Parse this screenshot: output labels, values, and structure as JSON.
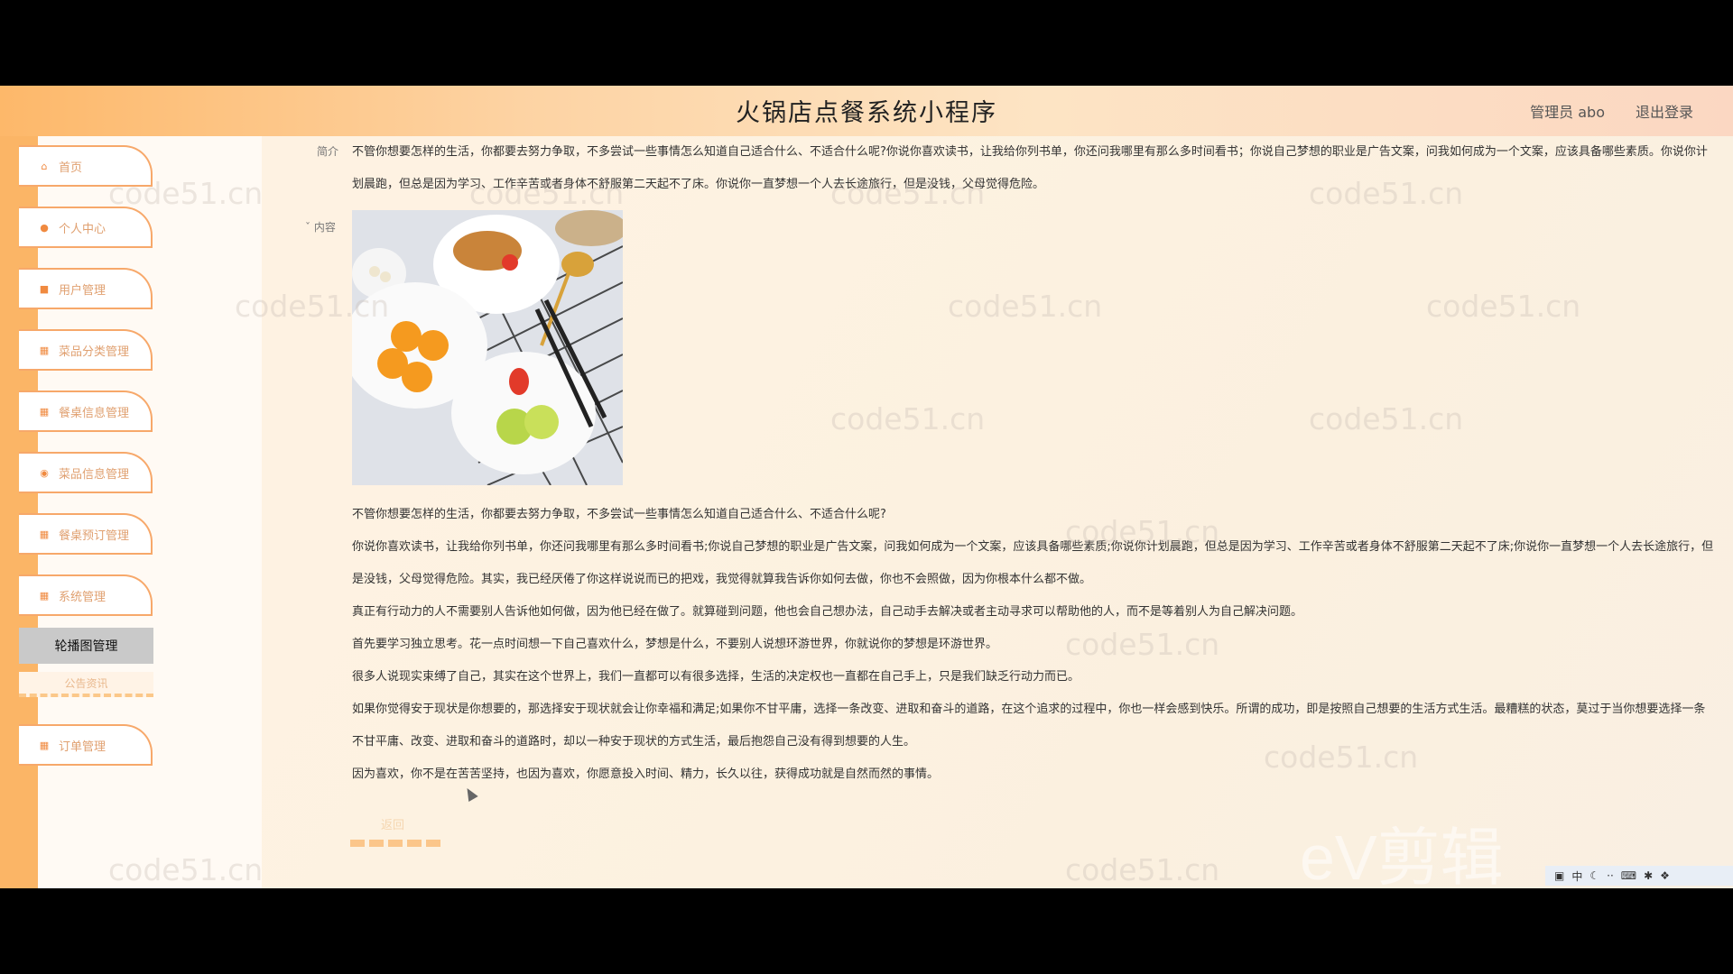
{
  "header": {
    "title": "火锅店点餐系统小程序",
    "user": "管理员 abo",
    "logout": "退出登录"
  },
  "sidebar": {
    "items": [
      {
        "label": "首页",
        "icon": "home-icon"
      },
      {
        "label": "个人中心",
        "icon": "user-icon"
      },
      {
        "label": "用户管理",
        "icon": "users-icon"
      },
      {
        "label": "菜品分类管理",
        "icon": "grid-icon"
      },
      {
        "label": "餐桌信息管理",
        "icon": "grid-icon"
      },
      {
        "label": "菜品信息管理",
        "icon": "info-icon"
      },
      {
        "label": "餐桌预订管理",
        "icon": "grid-icon"
      },
      {
        "label": "系统管理",
        "icon": "grid-icon"
      }
    ],
    "submenu_active": "轮播图管理",
    "submenu_other": "公告资讯",
    "last_item": {
      "label": "订单管理",
      "icon": "grid-icon"
    }
  },
  "detail": {
    "intro_label": "简介",
    "intro_text": "不管你想要怎样的生活，你都要去努力争取，不多尝试一些事情怎么知道自己适合什么、不适合什么呢?你说你喜欢读书，让我给你列书单，你还问我哪里有那么多时间看书；你说自己梦想的职业是广告文案，问我如何成为一个文案，应该具备哪些素质。你说你计划晨跑，但总是因为学习、工作辛苦或者身体不舒服第二天起不了床。你说你一直梦想一个人去长途旅行，但是没钱，父母觉得危险。",
    "content_label": "内容",
    "paragraphs": [
      "不管你想要怎样的生活，你都要去努力争取，不多尝试一些事情怎么知道自己适合什么、不适合什么呢?",
      "你说你喜欢读书，让我给你列书单，你还问我哪里有那么多时间看书;你说自己梦想的职业是广告文案，问我如何成为一个文案，应该具备哪些素质;你说你计划晨跑，但总是因为学习、工作辛苦或者身体不舒服第二天起不了床;你说你一直梦想一个人去长途旅行，但是没钱，父母觉得危险。其实，我已经厌倦了你这样说说而已的把戏，我觉得就算我告诉你如何去做，你也不会照做，因为你根本什么都不做。",
      "真正有行动力的人不需要别人告诉他如何做，因为他已经在做了。就算碰到问题，他也会自己想办法，自己动手去解决或者主动寻求可以帮助他的人，而不是等着别人为自己解决问题。",
      "首先要学习独立思考。花一点时间想一下自己喜欢什么，梦想是什么，不要别人说想环游世界，你就说你的梦想是环游世界。",
      "很多人说现实束缚了自己，其实在这个世界上，我们一直都可以有很多选择，生活的决定权也一直都在自己手上，只是我们缺乏行动力而已。",
      "如果你觉得安于现状是你想要的，那选择安于现状就会让你幸福和满足;如果你不甘平庸，选择一条改变、进取和奋斗的道路，在这个追求的过程中，你也一样会感到快乐。所谓的成功，即是按照自己想要的生活方式生活。最糟糕的状态，莫过于当你想要选择一条不甘平庸、改变、进取和奋斗的道路时，却以一种安于现状的方式生活，最后抱怨自己没有得到想要的人生。",
      "因为喜欢，你不是在苦苦坚持，也因为喜欢，你愿意投入时间、精力，长久以往，获得成功就是自然而然的事情。"
    ],
    "return_button": "返回"
  },
  "watermark_text": "code51.cn",
  "overlay_logo": "eV剪辑",
  "tray": {
    "lang": "中"
  }
}
